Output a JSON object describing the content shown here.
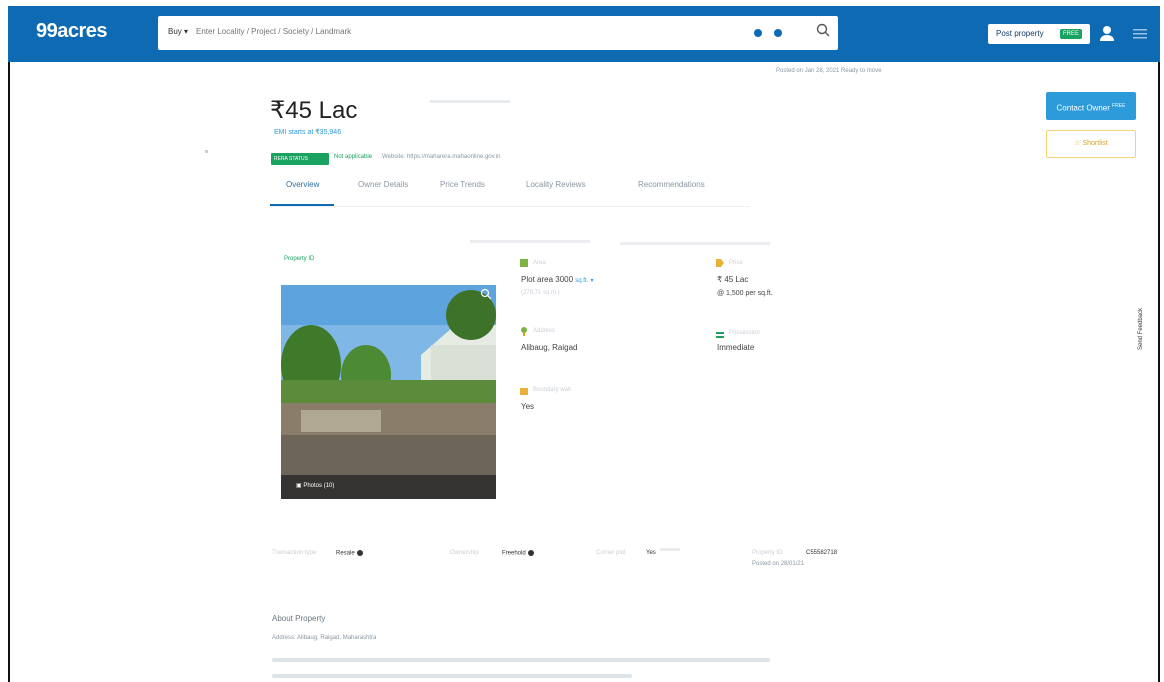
{
  "header": {
    "logo": "99acres",
    "search": {
      "buy_label": "Buy",
      "placeholder": "Enter Locality / Project / Society / Landmark"
    },
    "post_property": "Post property",
    "post_badge": "FREE"
  },
  "listing": {
    "posted": "Posted on Jan 28, 2021   Ready to move",
    "price": "₹45 Lac",
    "emi": "EMI starts at ₹35,946",
    "rera_badge": "RERA STATUS",
    "rera_link": "Not applicable",
    "rera_site": "Website: https://maharera.mahaonline.gov.in"
  },
  "tabs": [
    "Overview",
    "Owner Details",
    "Price Trends",
    "Locality Reviews",
    "Recommendations"
  ],
  "actions": {
    "contact": "Contact Owner",
    "contact_badge": "FREE",
    "shortlist": "Shortlist"
  },
  "property": {
    "id_label": "Property ID",
    "photos": "Photos (10)"
  },
  "details": {
    "area_label": "Area",
    "area_value": "Plot area 3000",
    "area_unit": "sq.ft.",
    "area_sub": "(278.71 sq.m.)",
    "price_label": "Price",
    "price_value": "₹ 45 Lac",
    "price_sub": "@ 1,500 per sq.ft.",
    "location_label": "Address",
    "location_value": "Alibaug, Raigad",
    "possession_label": "Possession",
    "possession_value": "Immediate",
    "boundary_label": "Boundary wall",
    "boundary_value": "Yes"
  },
  "facts": {
    "transaction_label": "Transaction type",
    "transaction_value": "Resale",
    "ownership_label": "Ownership",
    "ownership_value": "Freehold",
    "corner_label": "Corner plot",
    "corner_value": "Yes",
    "pid_label": "Property ID",
    "pid_value": "C55582718",
    "pid_sub": "Posted on 28/01/21"
  },
  "about": {
    "heading": "About Property",
    "address": "Address: Alibaug, Raigad, Maharashtra"
  },
  "feedback": "Send Feedback"
}
